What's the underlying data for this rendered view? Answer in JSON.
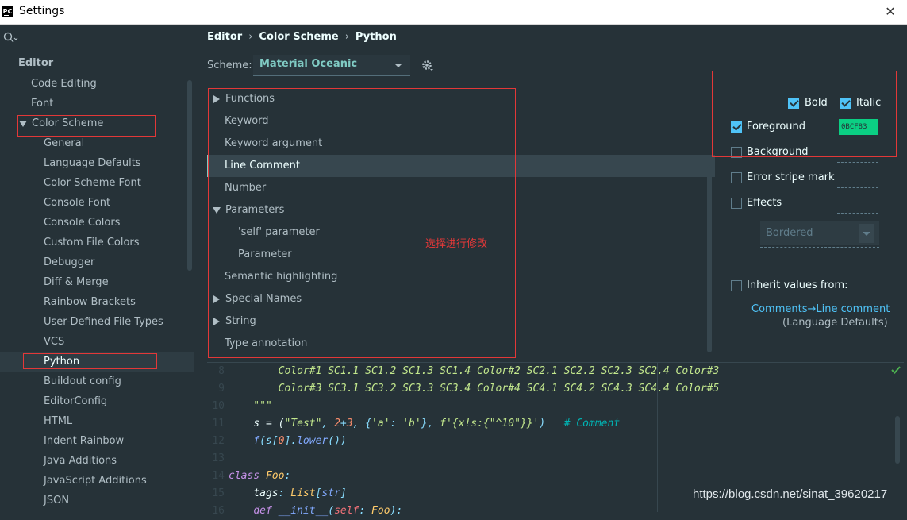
{
  "window": {
    "title": "Settings",
    "app_icon_text": "PC"
  },
  "search": {
    "placeholder": ""
  },
  "sidebar": {
    "section": "Editor",
    "items": [
      {
        "label": "Code Editing"
      },
      {
        "label": "Font"
      },
      {
        "label": "Color Scheme"
      },
      {
        "label": "General"
      },
      {
        "label": "Language Defaults"
      },
      {
        "label": "Color Scheme Font"
      },
      {
        "label": "Console Font"
      },
      {
        "label": "Console Colors"
      },
      {
        "label": "Custom File Colors"
      },
      {
        "label": "Debugger"
      },
      {
        "label": "Diff & Merge"
      },
      {
        "label": "Rainbow Brackets"
      },
      {
        "label": "User-Defined File Types"
      },
      {
        "label": "VCS"
      },
      {
        "label": "Python"
      },
      {
        "label": "Buildout config"
      },
      {
        "label": "EditorConfig"
      },
      {
        "label": "HTML"
      },
      {
        "label": "Indent Rainbow"
      },
      {
        "label": "Java Additions"
      },
      {
        "label": "JavaScript Additions"
      },
      {
        "label": "JSON"
      }
    ]
  },
  "breadcrumb": {
    "part1": "Editor",
    "part2": "Color Scheme",
    "part3": "Python",
    "sep": "›"
  },
  "scheme": {
    "label": "Scheme:",
    "value": "Material Oceanic"
  },
  "attributes": {
    "items": [
      {
        "label": "Functions"
      },
      {
        "label": "Keyword"
      },
      {
        "label": "Keyword argument"
      },
      {
        "label": "Line Comment"
      },
      {
        "label": "Number"
      },
      {
        "label": "Parameters"
      },
      {
        "label": "'self' parameter"
      },
      {
        "label": "Parameter"
      },
      {
        "label": "Semantic highlighting"
      },
      {
        "label": "Special Names"
      },
      {
        "label": "String"
      },
      {
        "label": "Type annotation"
      }
    ]
  },
  "annotation": "选择进行修改",
  "properties": {
    "bold": "Bold",
    "italic": "Italic",
    "foreground": "Foreground",
    "foreground_value": "0BCF83",
    "foreground_color": "#0bcf83",
    "background": "Background",
    "error_stripe": "Error stripe mark",
    "effects": "Effects",
    "effects_type": "Bordered",
    "inherit": "Inherit values from:",
    "inherit_link": "Comments→Line comment",
    "inherit_source": "(Language Defaults)"
  },
  "editor": {
    "lines": [
      {
        "n": "8",
        "text": "        Color#1 SC1.1 SC1.2 SC1.3 SC1.4 Color#2 SC2.1 SC2.2 SC2.3 SC2.4 Color#3"
      },
      {
        "n": "9",
        "text": "        Color#3 SC3.1 SC3.2 SC3.3 SC3.4 Color#4 SC4.1 SC4.2 SC4.3 SC4.4 Color#5"
      },
      {
        "n": "10",
        "text": "    \"\"\""
      },
      {
        "n": "11",
        "s_head": "    s = (",
        "str1": "\"Test\"",
        "p1": ", ",
        "num1": "2",
        "op1": "+",
        "num2": "3",
        "p2": ", {",
        "str2": "'a'",
        "p3": ": ",
        "str3": "'b'",
        "p4": "}, ",
        "fstr": "f'{x!s:{\"^10\"}}'",
        "p5": ")   ",
        "comment": "# Comment"
      },
      {
        "n": "12",
        "head": "    ",
        "fn": "f",
        "p1": "(s[",
        "num": "0",
        "p2": "].",
        "m": "lower",
        "p3": "())"
      },
      {
        "n": "13",
        "text": ""
      },
      {
        "n": "14",
        "kw": "class",
        "sp": " ",
        "cls": "Foo",
        "colon": ":"
      },
      {
        "n": "15",
        "head": "    ",
        "attr": "tags",
        "colon": ": ",
        "type": "List",
        "p1": "[",
        "str": "str",
        "p2": "]"
      },
      {
        "n": "16",
        "head": "    ",
        "kw": "def",
        "sp": " ",
        "name": "__init__",
        "p1": "(",
        "self": "self",
        "p2": ": ",
        "cls": "Foo",
        "p3": "):"
      }
    ]
  },
  "watermark": "https://blog.csdn.net/sinat_39620217"
}
